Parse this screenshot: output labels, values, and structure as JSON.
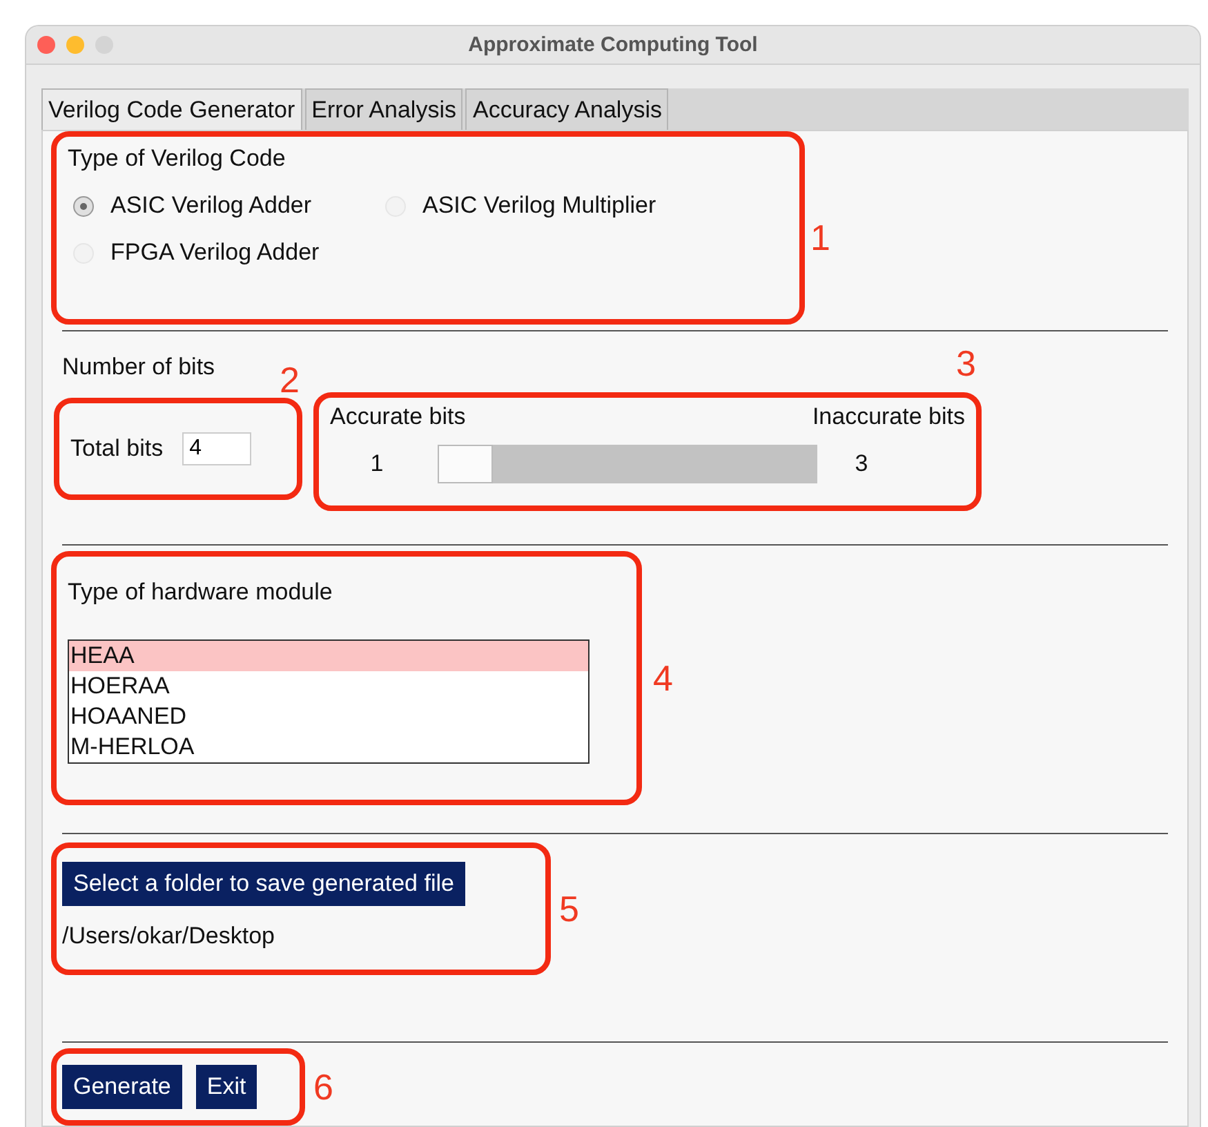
{
  "window": {
    "title": "Approximate Computing Tool"
  },
  "tabs": [
    {
      "label": "Verilog Code Generator",
      "selected": true
    },
    {
      "label": "Error Analysis",
      "selected": false
    },
    {
      "label": "Accuracy Analysis",
      "selected": false
    }
  ],
  "verilog_type": {
    "label": "Type of Verilog Code",
    "annotation": "1",
    "options": [
      {
        "label": "ASIC Verilog Adder",
        "selected": true
      },
      {
        "label": "ASIC Verilog Multiplier",
        "selected": false
      },
      {
        "label": "FPGA Verilog Adder",
        "selected": false
      }
    ]
  },
  "bits": {
    "label": "Number of bits",
    "total": {
      "label": "Total bits",
      "value": "4",
      "annotation": "2"
    },
    "slider": {
      "left_label": "Accurate bits",
      "right_label": "Inaccurate bits",
      "left_value": "1",
      "right_value": "3",
      "level": 0,
      "annotation": "3"
    }
  },
  "hardware": {
    "label": "Type of hardware module",
    "annotation": "4",
    "items": [
      {
        "label": "HEAA",
        "selected": true
      },
      {
        "label": "HOERAA",
        "selected": false
      },
      {
        "label": "HOAANED",
        "selected": false
      },
      {
        "label": "M-HERLOA",
        "selected": false
      }
    ]
  },
  "folder": {
    "button": "Select a folder to save generated file",
    "path": "/Users/okar/Desktop",
    "annotation": "5"
  },
  "actions": {
    "buttons": [
      "Generate",
      "Exit"
    ],
    "annotation": "6"
  }
}
